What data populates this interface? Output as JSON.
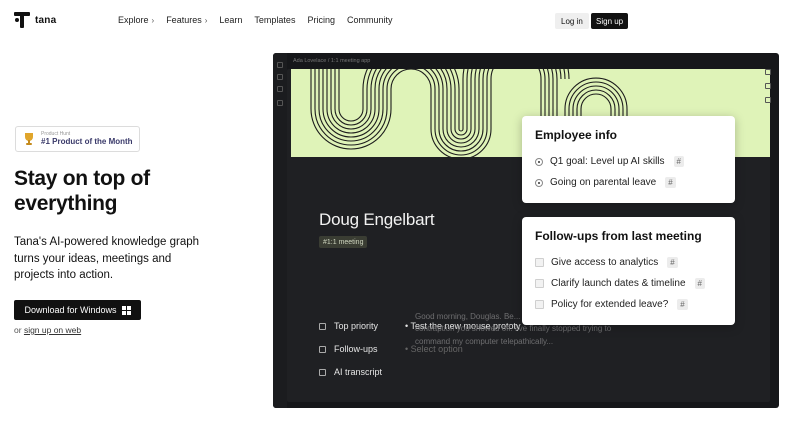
{
  "nav": {
    "brand": "tana",
    "links": [
      {
        "label": "Explore",
        "has_chevron": true
      },
      {
        "label": "Features",
        "has_chevron": true
      },
      {
        "label": "Learn",
        "has_chevron": false
      },
      {
        "label": "Templates",
        "has_chevron": false
      },
      {
        "label": "Pricing",
        "has_chevron": false
      },
      {
        "label": "Community",
        "has_chevron": false
      }
    ],
    "chevron": "›",
    "login": "Log in",
    "signup": "Sign up"
  },
  "hero": {
    "badge_small": "Product Hunt",
    "badge_main": "#1 Product of the Month",
    "title": "Stay on top of everything",
    "subtitle": "Tana's AI-powered knowledge graph turns your ideas, meetings and projects into action.",
    "download": "Download for Windows",
    "or_text": "or",
    "signup_web": "sign up on web"
  },
  "app": {
    "breadcrumb": "Ada Lovelace  /  1:1 meeting app",
    "node_title": "Doug Engelbart",
    "node_tag": "#1:1 meeting",
    "fields": [
      {
        "label": "Top priority",
        "value": "Test the new mouse prototy",
        "bullet": "•",
        "muted": false
      },
      {
        "label": "Follow-ups",
        "value": "Select option",
        "bullet": "•",
        "muted": true
      },
      {
        "label": "AI transcript",
        "value": "",
        "bullet": "",
        "muted": false
      }
    ],
    "transcript": "Good morning, Douglas. Be... —I love the new \"mouse\" contraption you showed off. I've finally stopped trying to command my computer telepathically..."
  },
  "cards": {
    "employee": {
      "title": "Employee info",
      "items": [
        {
          "text": "Q1 goal: Level up AI skills",
          "tag": "#"
        },
        {
          "text": "Going on parental leave",
          "tag": "#"
        }
      ]
    },
    "followups": {
      "title": "Follow-ups from last meeting",
      "items": [
        {
          "text": "Give access to analytics",
          "tag": "#"
        },
        {
          "text": "Clarify launch dates & timeline",
          "tag": "#"
        },
        {
          "text": "Policy for extended leave?",
          "tag": "#"
        }
      ]
    }
  },
  "colors": {
    "banner": "#dff3b8",
    "app_bg": "#16171a",
    "accent_dark": "#111111"
  },
  "icons": {
    "logo": "tana-logo-icon",
    "trophy": "trophy-icon",
    "windows": "windows-icon"
  }
}
